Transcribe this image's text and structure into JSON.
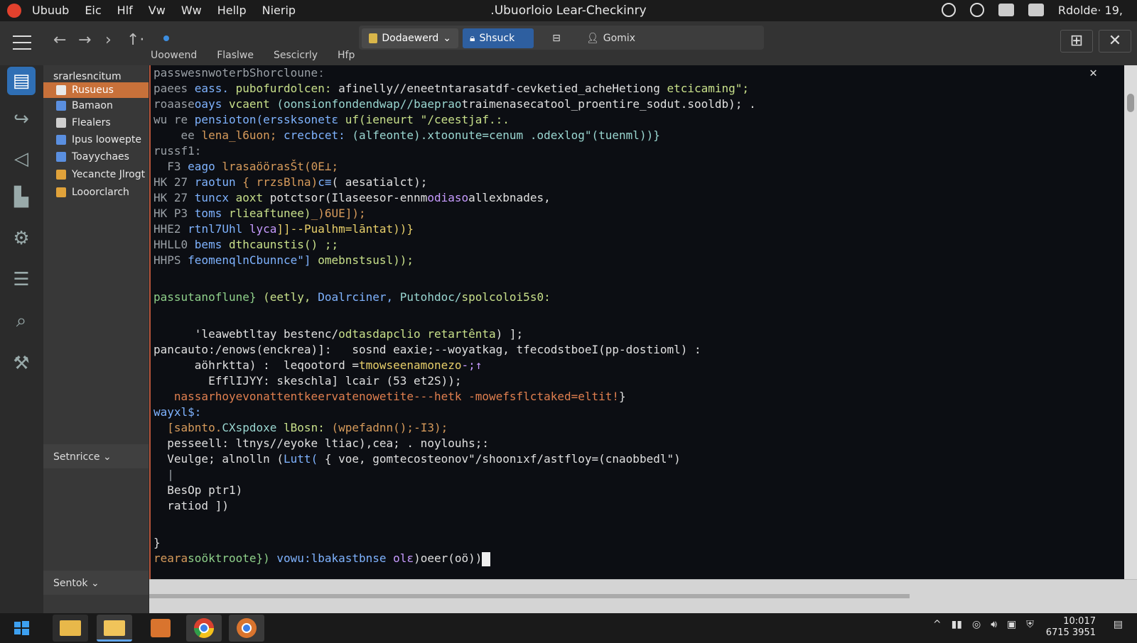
{
  "topbar": {
    "menu": [
      "Ubuub",
      "Eic",
      "Hlf",
      "Vw",
      "Ww",
      "Hellp",
      "Nierip"
    ],
    "title": ".Ubuorloio Lear-Checkinry",
    "status_text": "Rdolde· 19,"
  },
  "toolbar": {
    "tabs": [
      {
        "label": "Dodaewerd",
        "icon": "folder-icon",
        "active": true
      },
      {
        "label": "Shsuck",
        "icon": "lock-icon",
        "active": false
      },
      {
        "label": "",
        "icon": "window-icon",
        "active": false
      },
      {
        "label": "Gomix",
        "icon": "user-icon",
        "active": false
      }
    ],
    "subtabs": [
      "Uoowend",
      "Flaslwe",
      "Sescicrly",
      "Hfp"
    ]
  },
  "sidebar": {
    "heading": "srarlesncitum",
    "items": [
      {
        "label": "Rusueus",
        "selected": true,
        "icon": "folder-icon",
        "color": "#e8e8e8"
      },
      {
        "label": "Bamaon",
        "selected": false,
        "icon": "shield-icon",
        "color": "#5a8fe0"
      },
      {
        "label": "Flealers",
        "selected": false,
        "icon": "doc-icon",
        "color": "#cfcfcf"
      },
      {
        "label": "Ipus Ioowepte",
        "selected": false,
        "icon": "check-icon",
        "color": "#5a8fe0"
      },
      {
        "label": "Toayychaes",
        "selected": false,
        "icon": "check-icon",
        "color": "#5a8fe0"
      },
      {
        "label": "Yecancte Jlrogt",
        "selected": false,
        "icon": "check-icon",
        "color": "#e0a23a"
      },
      {
        "label": "Looorclarch",
        "selected": false,
        "icon": "folder-icon",
        "color": "#e0a23a"
      }
    ],
    "section1": "Setnricce ⌄",
    "section2": "Sentok ⌄"
  },
  "terminal": {
    "lines": [
      [
        {
          "t": "passwesnwoterbShorclouneː",
          "c": "pf"
        }
      ],
      [
        {
          "t": "paees ",
          "c": "pf"
        },
        {
          "t": "eass. ",
          "c": "kw"
        },
        {
          "t": "pubofurdolcen: ",
          "c": "fn"
        },
        {
          "t": "afinelly//eneetntarasatdf-cevketied_acheHetiong ",
          "c": ""
        },
        {
          "t": "etcicaming\";",
          "c": "fn"
        }
      ],
      [
        {
          "t": "roaase",
          "c": "pf"
        },
        {
          "t": "oays ",
          "c": "kw"
        },
        {
          "t": "vcaent ",
          "c": "fn"
        },
        {
          "t": "(oonsionfondendwap//baeprao",
          "c": "ty"
        },
        {
          "t": "traimenasecatool_proentire_sodut.sooldb); .",
          "c": ""
        }
      ],
      [
        {
          "t": "wu re ",
          "c": "pf"
        },
        {
          "t": "pensioton(erssksonetɛ ",
          "c": "kw"
        },
        {
          "t": "uf(ieneurt \"/ceestjaf.:.",
          "c": "fn"
        }
      ],
      [
        {
          "t": "    ee ",
          "c": "pf"
        },
        {
          "t": "lena_l6uon; ",
          "c": "st"
        },
        {
          "t": "crecbcet: ",
          "c": "kw"
        },
        {
          "t": "(alfeonte).xtoonute=cenum .odexlog\"(tuenml))}",
          "c": "ty"
        }
      ],
      [
        {
          "t": "russf1:",
          "c": "pf"
        }
      ],
      [
        {
          "t": "  F3 ",
          "c": "pf"
        },
        {
          "t": "eago ",
          "c": "kw"
        },
        {
          "t": "lrasaöörasŠt(0E⊥;",
          "c": "st"
        }
      ],
      [
        {
          "t": "HK 27 ",
          "c": "pf"
        },
        {
          "t": "raotun ",
          "c": "kw"
        },
        {
          "t": "{ rrzsBlna)",
          "c": "st"
        },
        {
          "t": "c≡",
          "c": "kw"
        },
        {
          "t": "( aesatialct);",
          "c": ""
        }
      ],
      [
        {
          "t": "HK 27 ",
          "c": "pf"
        },
        {
          "t": "tuncx ",
          "c": "kw"
        },
        {
          "t": "aoxt ",
          "c": "fn"
        },
        {
          "t": "potctsor(Ilaseesor-ennm",
          "c": ""
        },
        {
          "t": "odiaso",
          "c": "vi"
        },
        {
          "t": "allexbnades,",
          "c": ""
        }
      ],
      [
        {
          "t": "HK P3 ",
          "c": "pf"
        },
        {
          "t": "toms ",
          "c": "kw"
        },
        {
          "t": "rlieaftunee)",
          "c": "fn"
        },
        {
          "t": "_)6UE]);",
          "c": "st"
        }
      ],
      [
        {
          "t": "HHE2 ",
          "c": "pf"
        },
        {
          "t": "rtnl7Uhl ",
          "c": "kw"
        },
        {
          "t": "lyca",
          "c": "vi"
        },
        {
          "t": "]]--Pualhm=lāntat))}",
          "c": "ye"
        }
      ],
      [
        {
          "t": "HHLL0 ",
          "c": "pf"
        },
        {
          "t": "bems ",
          "c": "kw"
        },
        {
          "t": "dthcaunstis() ;;",
          "c": "fn"
        }
      ],
      [
        {
          "t": "HHPS ",
          "c": "pf"
        },
        {
          "t": "feomenqlnCbunnce\"] ",
          "c": "kw"
        },
        {
          "t": "omebnstsusl));",
          "c": "fn"
        }
      ],
      [],
      [
        {
          "t": "passutanoflune} ",
          "c": "gr"
        },
        {
          "t": "(eetly, ",
          "c": "fn"
        },
        {
          "t": "Doalrciner, ",
          "c": "kw"
        },
        {
          "t": "Putohdoc/",
          "c": "ty"
        },
        {
          "t": "spolcoloi5s0:",
          "c": "fn"
        }
      ],
      [],
      [
        {
          "t": "      'leawebtltay bestenc/",
          "c": ""
        },
        {
          "t": "odtasdapclio retartênta",
          "c": "fn"
        },
        {
          "t": ") ];",
          "c": ""
        }
      ],
      [
        {
          "t": "pancauto:/enows(enckrea)]:   sosnd eaxie;--woyatkag, tfecodstboeI(pp-dostioml) :",
          "c": ""
        }
      ],
      [
        {
          "t": "      aöhrktta) :  leqootord =",
          "c": ""
        },
        {
          "t": "tmowseenamonezo",
          "c": "ye"
        },
        {
          "t": "-;↑",
          "c": "vi"
        }
      ],
      [
        {
          "t": "        EfflIJYY: skeschla] lcair (53 et2S));",
          "c": ""
        }
      ],
      [
        {
          "t": "   nassarhoyevonattentkeervatenowetite---hetk -mowefsflctaked=eltit!",
          "c": "cm"
        },
        {
          "t": "}",
          "c": ""
        }
      ],
      [
        {
          "t": "wayxl$:",
          "c": "kw"
        }
      ],
      [
        {
          "t": "  [sabnto.",
          "c": "st"
        },
        {
          "t": "CXspdoxe ",
          "c": "ty"
        },
        {
          "t": "lBosn: ",
          "c": "fn"
        },
        {
          "t": "(wpefadnn();-I3);",
          "c": "st"
        }
      ],
      [
        {
          "t": "  pesseell: ltnys//eyoke ltiac),cea; . noylouhs;:",
          "c": ""
        }
      ],
      [
        {
          "t": "  Veulge; alnolln (",
          "c": ""
        },
        {
          "t": "Lutt( ",
          "c": "kw"
        },
        {
          "t": "{ voe, gomtecosteonov\"/shoonıxf/astfloy=(cnaobbedl\")",
          "c": ""
        }
      ],
      [
        {
          "t": "  |",
          "c": "pf"
        }
      ],
      [
        {
          "t": "  BesOp ptr1)",
          "c": ""
        }
      ],
      [
        {
          "t": "  ratiod ])",
          "c": ""
        }
      ],
      [],
      [
        {
          "t": "}",
          "c": ""
        }
      ],
      [
        {
          "t": "reara",
          "c": "st"
        },
        {
          "t": "soöktroote}) ",
          "c": "gr"
        },
        {
          "t": "vowu:lbakastbnse ",
          "c": "kw"
        },
        {
          "t": "olɛ",
          "c": "vi"
        },
        {
          "t": ")oeer(oö))",
          "c": ""
        }
      ]
    ]
  },
  "taskbar": {
    "clock_time": "10:017",
    "clock_date": "6715 3951"
  },
  "colors": {
    "accent_selected": "#c8713a",
    "dock_selected": "#2f6fb5",
    "shared_tab": "#2e5fa0",
    "terminal_bg": "#0c0e13"
  }
}
